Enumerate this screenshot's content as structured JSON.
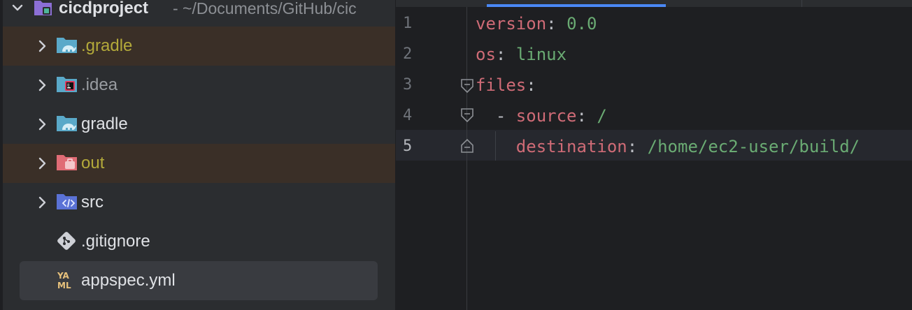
{
  "project": {
    "name": "cicdproject",
    "path": "- ~/Documents/GitHub/cic"
  },
  "tree": {
    "gradle_dot": ".gradle",
    "idea": ".idea",
    "gradle": "gradle",
    "out": "out",
    "src": "src",
    "gitignore": ".gitignore",
    "appspec": "appspec.yml"
  },
  "editor": {
    "lines": [
      {
        "num": "1",
        "key": "version",
        "sep": ": ",
        "value": "0.0",
        "indent": ""
      },
      {
        "num": "2",
        "key": "os",
        "sep": ": ",
        "value": "linux",
        "indent": ""
      },
      {
        "num": "3",
        "key": "files",
        "sep": ":",
        "value": "",
        "indent": ""
      },
      {
        "num": "4",
        "key": "source",
        "sep": ": ",
        "value": "/",
        "indent": "  - "
      },
      {
        "num": "5",
        "key": "destination",
        "sep": ": ",
        "value": "/home/ec2-user/build/",
        "indent": "    "
      }
    ],
    "current_line": "5"
  },
  "colors": {
    "key": "#cf6b76",
    "value": "#6aab73",
    "ignored_row": "#3a2f27",
    "selected_row": "#393b40",
    "tab_indicator": "#4a88f5"
  },
  "icons": {
    "chevron": "chevron-right-icon",
    "module": "module-icon",
    "folder": "folder-icon"
  }
}
